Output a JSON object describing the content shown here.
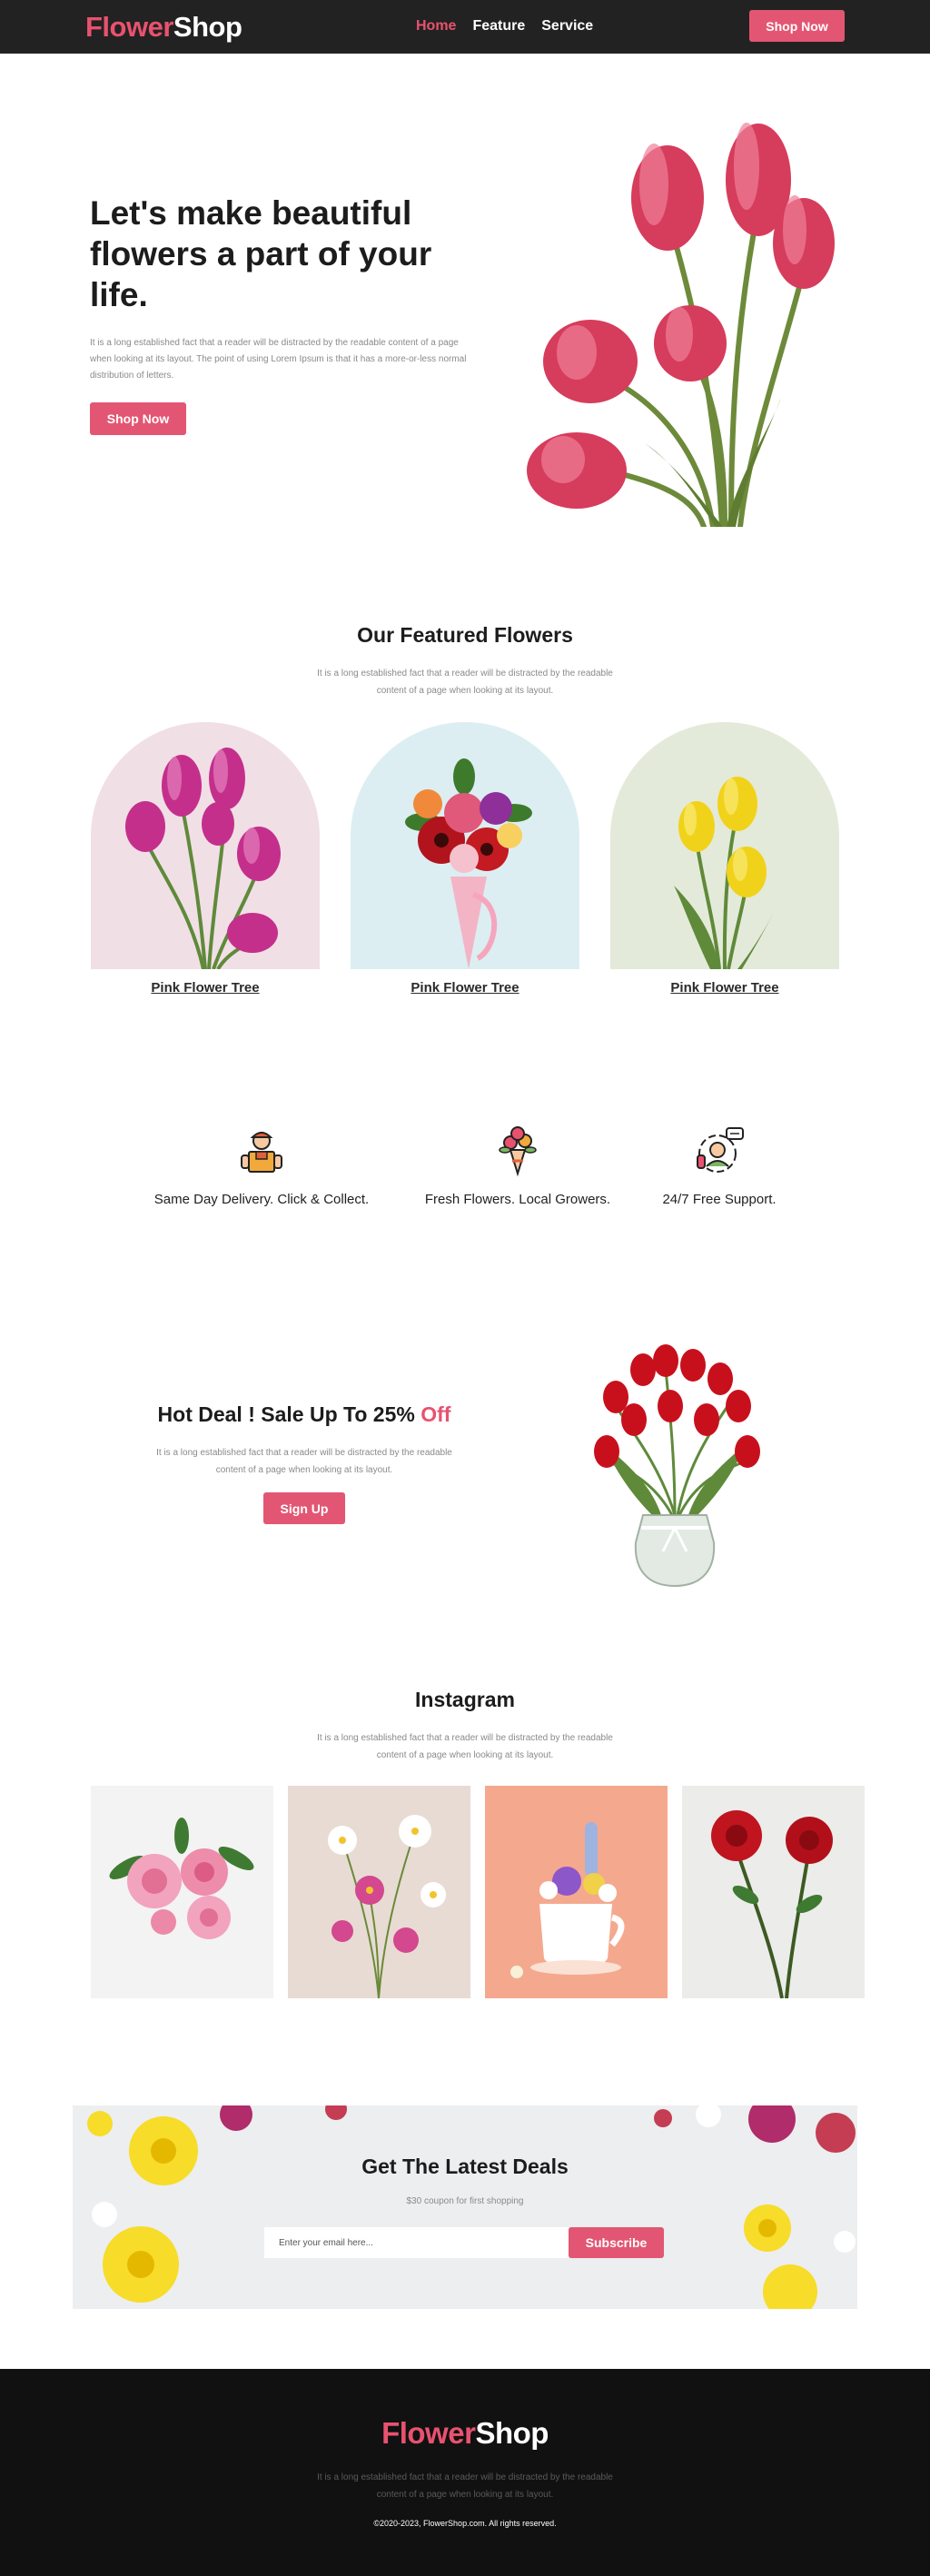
{
  "nav": {
    "logo_part1": "Flower",
    "logo_part2": "Shop",
    "links": [
      "Home",
      "Feature",
      "Service"
    ],
    "button": "Shop Now"
  },
  "hero": {
    "title": "Let's make beautiful flowers a part of your life.",
    "text": "It is a long established fact that a reader will be distracted by the readable content of a page when looking at its layout. The point of using Lorem Ipsum is that it has a more-or-less normal distribution of letters.",
    "button": "Shop Now"
  },
  "featured": {
    "title": "Our Featured Flowers",
    "text": "It is a long established fact that a reader will be distracted by the readable content of a page when looking at its layout.",
    "cards": [
      {
        "label": "Pink Flower Tree",
        "bg": "#f1dfe6"
      },
      {
        "label": "Pink Flower Tree",
        "bg": "#dceef2"
      },
      {
        "label": "Pink Flower Tree",
        "bg": "#e4ead9"
      }
    ]
  },
  "features": [
    {
      "label": "Same Day Delivery. Click & Collect.",
      "icon": "delivery-man-icon"
    },
    {
      "label": "Fresh Flowers. Local Growers.",
      "icon": "bouquet-icon"
    },
    {
      "label": "24/7 Free Support.",
      "icon": "support-agent-icon"
    }
  ],
  "deal": {
    "title_main": "Hot Deal ! Sale Up To 25% ",
    "title_accent": "Off",
    "text": "It is a long established fact that a reader will be distracted by the readable content of a page when looking at its layout.",
    "button": "Sign Up"
  },
  "instagram": {
    "title": "Instagram",
    "text": "It is a long established fact that a reader will be distracted by the readable content of a page when looking at its layout."
  },
  "newsletter": {
    "title": "Get The Latest Deals",
    "subtitle": "$30 coupon for first shopping",
    "placeholder": "Enter your email here...",
    "button": "Subscribe"
  },
  "footer": {
    "logo_part1": "Flower",
    "logo_part2": "Shop",
    "text": "It is a long established fact that a reader will be distracted by the readable content of a page when looking at its layout.",
    "copyright": "©2020-2023, FlowerShop.com. All rights reserved."
  },
  "colors": {
    "accent": "#e35673",
    "nav_bg": "#222222",
    "footer_bg": "#111111"
  }
}
